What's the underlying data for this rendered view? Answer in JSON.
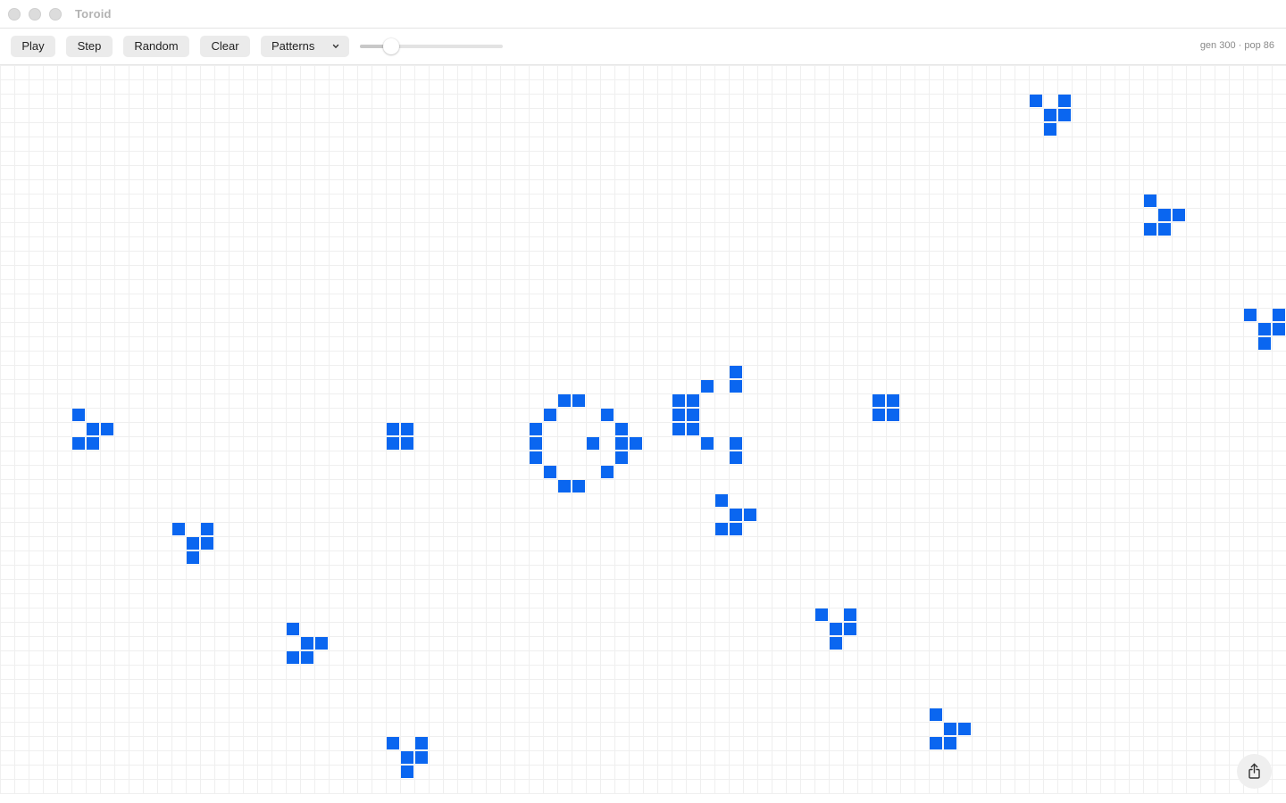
{
  "window": {
    "title": "Toroid"
  },
  "toolbar": {
    "play_label": "Play",
    "step_label": "Step",
    "random_label": "Random",
    "clear_label": "Clear",
    "patterns": {
      "selected": "Patterns",
      "icon": "chevron-down-icon"
    },
    "speed": {
      "value": 0.22
    },
    "status": "gen 300 · pop 86"
  },
  "board": {
    "cell_color": "#0a66f0",
    "grid_color": "#efefef",
    "live_cells": [
      [
        72,
        2
      ],
      [
        73,
        3
      ],
      [
        74,
        2
      ],
      [
        73,
        4
      ],
      [
        74,
        3
      ],
      [
        80,
        9
      ],
      [
        81,
        10
      ],
      [
        82,
        10
      ],
      [
        80,
        11
      ],
      [
        81,
        11
      ],
      [
        87,
        17
      ],
      [
        88,
        18
      ],
      [
        89,
        17
      ],
      [
        89,
        18
      ],
      [
        88,
        19
      ],
      [
        5,
        24
      ],
      [
        6,
        25
      ],
      [
        7,
        25
      ],
      [
        5,
        26
      ],
      [
        6,
        26
      ],
      [
        27,
        25
      ],
      [
        28,
        25
      ],
      [
        27,
        26
      ],
      [
        28,
        26
      ],
      [
        39,
        23
      ],
      [
        40,
        23
      ],
      [
        38,
        24
      ],
      [
        42,
        24
      ],
      [
        37,
        25
      ],
      [
        43,
        25
      ],
      [
        37,
        26
      ],
      [
        41,
        26
      ],
      [
        43,
        26
      ],
      [
        44,
        26
      ],
      [
        37,
        27
      ],
      [
        43,
        27
      ],
      [
        38,
        28
      ],
      [
        42,
        28
      ],
      [
        39,
        29
      ],
      [
        40,
        29
      ],
      [
        51,
        21
      ],
      [
        49,
        22
      ],
      [
        51,
        22
      ],
      [
        47,
        23
      ],
      [
        48,
        23
      ],
      [
        47,
        24
      ],
      [
        48,
        24
      ],
      [
        47,
        25
      ],
      [
        48,
        25
      ],
      [
        49,
        26
      ],
      [
        51,
        26
      ],
      [
        51,
        27
      ],
      [
        61,
        23
      ],
      [
        62,
        23
      ],
      [
        61,
        24
      ],
      [
        62,
        24
      ],
      [
        50,
        30
      ],
      [
        51,
        31
      ],
      [
        52,
        31
      ],
      [
        50,
        32
      ],
      [
        51,
        32
      ],
      [
        12,
        32
      ],
      [
        14,
        32
      ],
      [
        13,
        33
      ],
      [
        14,
        33
      ],
      [
        13,
        34
      ],
      [
        57,
        38
      ],
      [
        59,
        38
      ],
      [
        58,
        39
      ],
      [
        59,
        39
      ],
      [
        58,
        40
      ],
      [
        20,
        39
      ],
      [
        21,
        40
      ],
      [
        22,
        40
      ],
      [
        20,
        41
      ],
      [
        21,
        41
      ],
      [
        65,
        45
      ],
      [
        66,
        46
      ],
      [
        67,
        46
      ],
      [
        65,
        47
      ],
      [
        66,
        47
      ],
      [
        27,
        47
      ],
      [
        29,
        47
      ],
      [
        28,
        48
      ],
      [
        29,
        48
      ],
      [
        28,
        49
      ]
    ]
  },
  "share_icon": "share-icon"
}
